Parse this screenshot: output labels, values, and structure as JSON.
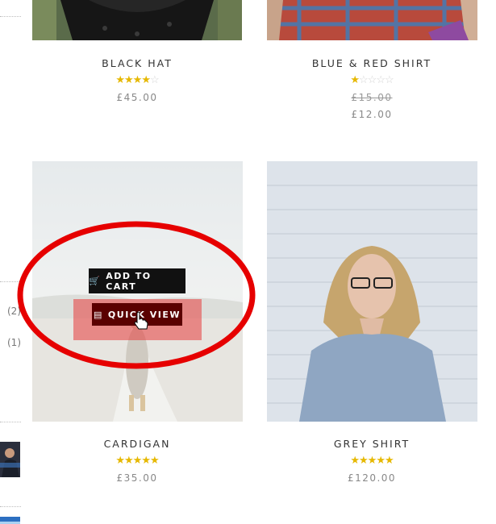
{
  "sidebar": {
    "counts": [
      "(2)",
      "(1)"
    ]
  },
  "products": [
    {
      "name": "BLACK HAT",
      "rating": 4,
      "price": "£45.00",
      "old_price": ""
    },
    {
      "name": "BLUE & RED SHIRT",
      "rating": 1,
      "price": "£12.00",
      "old_price": "£15.00"
    },
    {
      "name": "CARDIGAN",
      "rating": 5,
      "price": "£35.00",
      "old_price": ""
    },
    {
      "name": "GREY SHIRT",
      "rating": 5,
      "price": "£120.00",
      "old_price": ""
    }
  ],
  "hover_actions": {
    "add_to_cart": "ADD TO CART",
    "quick_view": "QUICK VIEW",
    "cart_icon": "cart-icon",
    "quick_view_icon": "document-icon"
  },
  "colors": {
    "star": "#e6b800",
    "annotation": "#e60000",
    "button_bg": "#111111",
    "highlight": "#e83c3c"
  }
}
